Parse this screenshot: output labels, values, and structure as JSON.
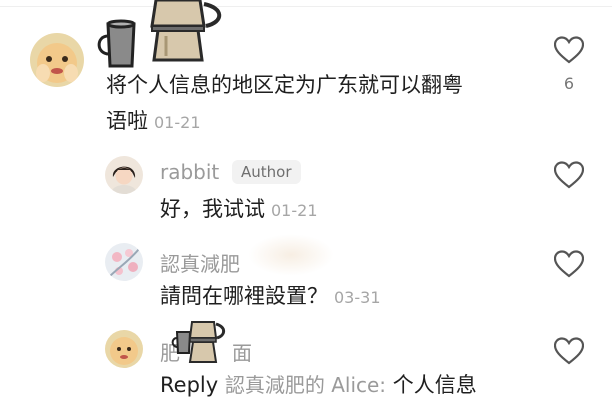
{
  "comments": [
    {
      "text_line1": "将个人信息的地区定为广东就可以翻粤",
      "text_line2": "语啦",
      "time": "01-21",
      "like_count": "6"
    }
  ],
  "replies": [
    {
      "username": "rabbit",
      "badge": "Author",
      "text": "好，我试试",
      "time": "01-21"
    },
    {
      "username": "認真減肥",
      "text": "請問在哪裡設置？",
      "time": "03-31"
    },
    {
      "username": "肥",
      "username_tail": "面",
      "reply_prefix": "Reply",
      "reply_target": "認真減肥的 Alice:",
      "text": "个人信息"
    }
  ],
  "colors": {
    "text": "#1f1f1f",
    "muted": "#9a9a9a",
    "badge_bg": "#f2f2f2",
    "heart_stroke": "#555555"
  },
  "icons": [
    "heart-outline-icon",
    "mug-sticker-icon",
    "moka-pot-sticker-icon"
  ]
}
